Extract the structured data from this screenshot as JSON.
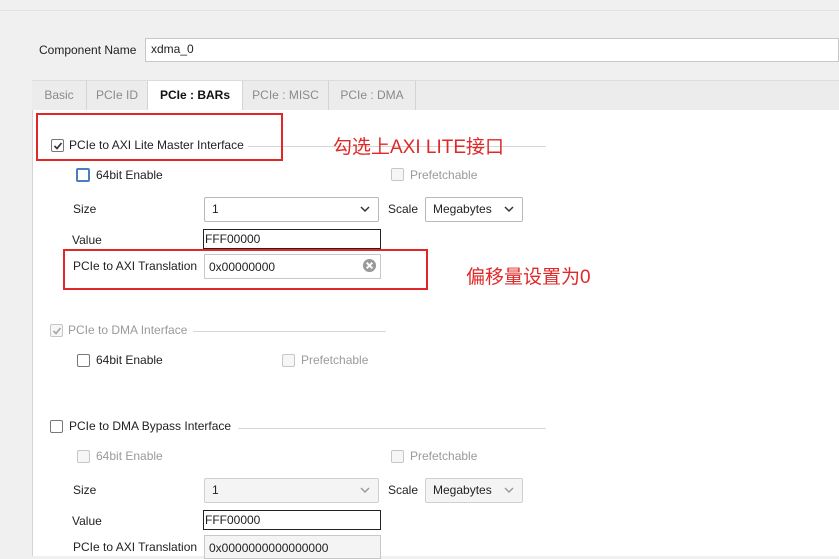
{
  "component": {
    "label": "Component Name",
    "value": "xdma_0"
  },
  "tabs": [
    "Basic",
    "PCIe ID",
    "PCIe : BARs",
    "PCIe : MISC",
    "PCIe : DMA"
  ],
  "active_tab": "PCIe : BARs",
  "lite_section": {
    "title": "PCIe to AXI Lite Master Interface",
    "checked": true,
    "enable_64bit": "64bit Enable",
    "prefetchable": "Prefetchable",
    "size_label": "Size",
    "size_value": "1",
    "scale_label": "Scale",
    "scale_value": "Megabytes",
    "value_label": "Value",
    "value": "FFF00000",
    "translation_label": "PCIe to AXI Translation",
    "translation_value": "0x00000000"
  },
  "dma_section": {
    "title": "PCIe to DMA Interface",
    "checked": true,
    "enable_64bit": "64bit Enable",
    "prefetchable": "Prefetchable"
  },
  "bypass_section": {
    "title": "PCIe to DMA Bypass Interface",
    "checked": false,
    "enable_64bit": "64bit Enable",
    "prefetchable": "Prefetchable",
    "size_label": "Size",
    "size_value": "1",
    "scale_label": "Scale",
    "scale_value": "Megabytes",
    "value_label": "Value",
    "value": "FFF00000",
    "translation_label": "PCIe to AXI Translation",
    "translation_value": "0x0000000000000000"
  },
  "annotations": {
    "note_lite": "勾选上AXI LITE接口",
    "note_offset": "偏移量设置为0",
    "color": "#e02828"
  },
  "colors": {
    "focus_blue": "#4a7ec2",
    "disabled_text": "#9a9a9a"
  }
}
